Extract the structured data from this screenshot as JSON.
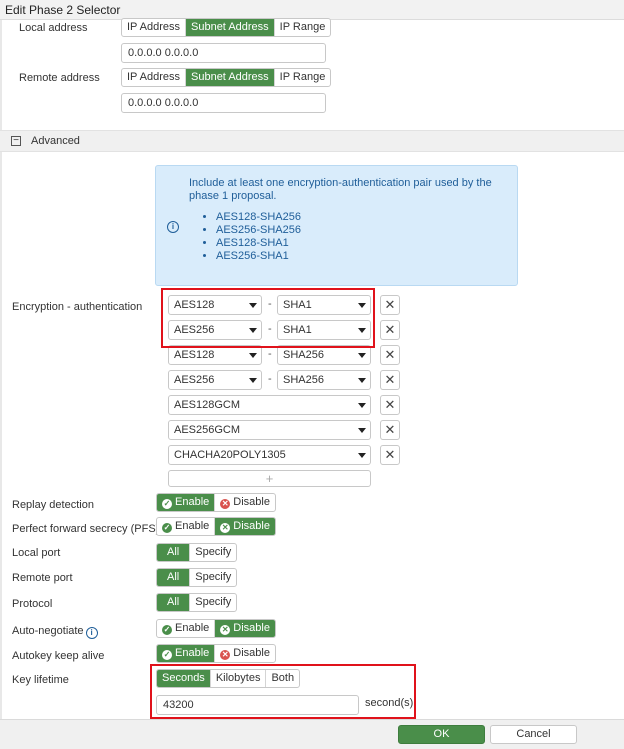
{
  "window": {
    "title": "Edit Phase 2 Selector"
  },
  "address_type_options": [
    "IP Address",
    "Subnet Address",
    "IP Range"
  ],
  "local_address": {
    "label": "Local address",
    "selected": "Subnet Address",
    "value": "0.0.0.0 0.0.0.0"
  },
  "remote_address": {
    "label": "Remote address",
    "selected": "Subnet Address",
    "value": "0.0.0.0 0.0.0.0"
  },
  "advanced": {
    "label": "Advanced",
    "toggle": "−"
  },
  "info_box": {
    "icon": "i",
    "message": "Include at least one encryption-authentication pair used by the phase 1 proposal.",
    "items": [
      "AES128-SHA256",
      "AES256-SHA256",
      "AES128-SHA1",
      "AES256-SHA1"
    ]
  },
  "encryption": {
    "label": "Encryption - authentication",
    "separator": "-",
    "remove_symbol": "✕",
    "add_symbol": "+",
    "pairs": [
      {
        "enc": "AES128",
        "auth": "SHA1"
      },
      {
        "enc": "AES256",
        "auth": "SHA1"
      },
      {
        "enc": "AES128",
        "auth": "SHA256"
      },
      {
        "enc": "AES256",
        "auth": "SHA256"
      },
      {
        "enc": "AES128GCM"
      },
      {
        "enc": "AES256GCM"
      },
      {
        "enc": "CHACHA20POLY1305"
      }
    ]
  },
  "enable_disable": {
    "enable": "Enable",
    "disable": "Disable"
  },
  "all_specify": {
    "all": "All",
    "specify": "Specify"
  },
  "replay_detection": {
    "label": "Replay detection",
    "selected": "Enable"
  },
  "pfs": {
    "label": "Perfect forward secrecy (PFS)",
    "selected": "Disable"
  },
  "local_port": {
    "label": "Local port",
    "selected": "All"
  },
  "remote_port": {
    "label": "Remote port",
    "selected": "All"
  },
  "protocol": {
    "label": "Protocol",
    "selected": "All"
  },
  "auto_negotiate": {
    "label": "Auto-negotiate",
    "help_icon": "i",
    "selected": "Disable"
  },
  "autokey_keep_alive": {
    "label": "Autokey keep alive",
    "selected": "Enable"
  },
  "key_lifetime": {
    "label": "Key lifetime",
    "options": [
      "Seconds",
      "Kilobytes",
      "Both"
    ],
    "selected": "Seconds",
    "value": "43200",
    "unit": "second(s)"
  },
  "buttons": {
    "ok": "OK",
    "cancel": "Cancel"
  },
  "colors": {
    "accent_green": "#4a8e4a",
    "highlight_red": "#e0121b",
    "info_bg": "#d9ecfb",
    "info_text": "#1f5e99"
  }
}
